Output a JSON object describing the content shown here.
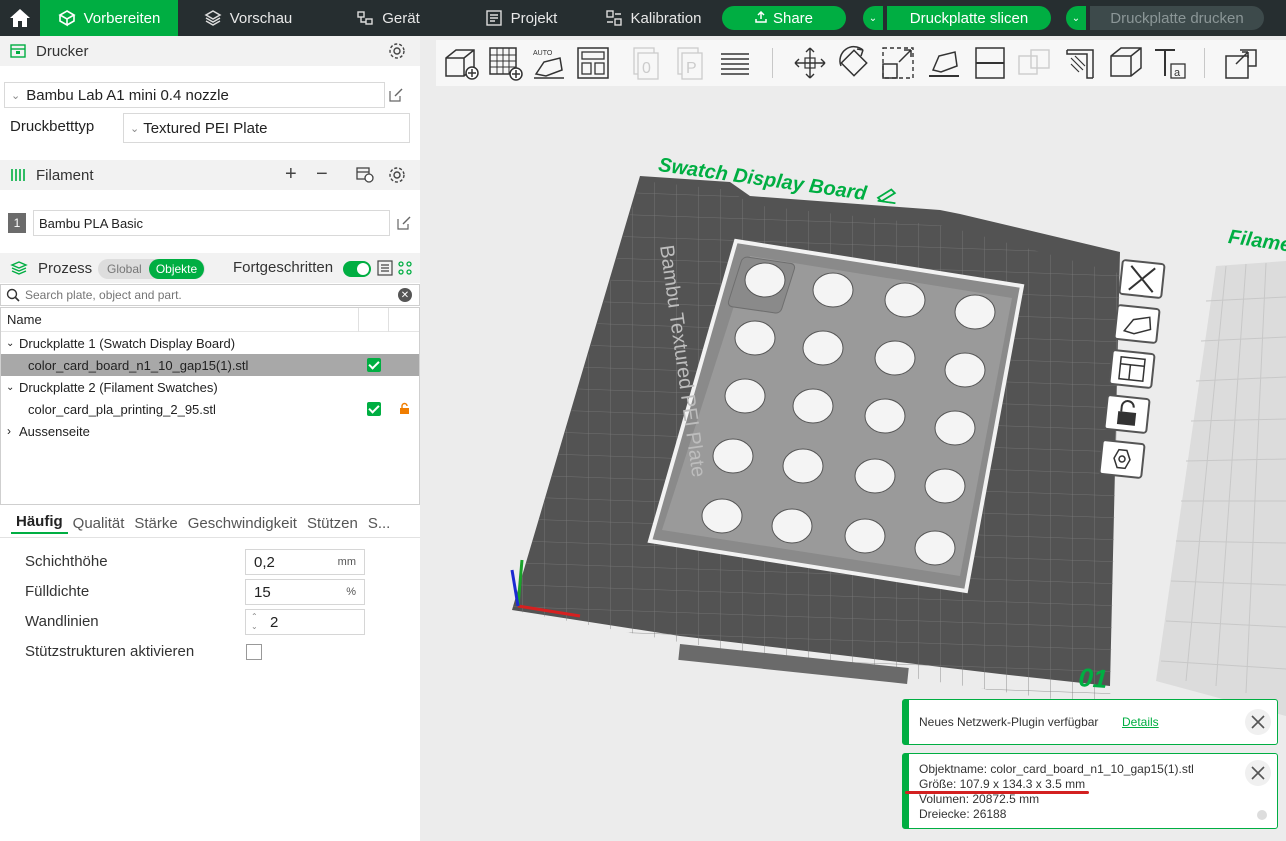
{
  "nav": {
    "tabs": [
      {
        "label": "Vorbereiten",
        "icon": "cube-icon"
      },
      {
        "label": "Vorschau",
        "icon": "layers-icon"
      },
      {
        "label": "Gerät",
        "icon": "device-icon"
      },
      {
        "label": "Projekt",
        "icon": "project-icon"
      },
      {
        "label": "Kalibration",
        "icon": "calibration-icon"
      }
    ],
    "share_label": "Share",
    "slice_label": "Druckplatte slicen",
    "print_label": "Druckplatte drucken",
    "accent": "#00ae42"
  },
  "printer": {
    "section_title": "Drucker",
    "printer_name": "Bambu Lab A1 mini 0.4 nozzle",
    "bed_type_label": "Druckbetttyp",
    "bed_type_value": "Textured PEI Plate"
  },
  "filament": {
    "section_title": "Filament",
    "slot_number": "1",
    "name": "Bambu PLA Basic"
  },
  "process": {
    "section_title": "Prozess",
    "toggle_global": "Global",
    "toggle_objects": "Objekte",
    "advanced_label": "Fortgeschritten",
    "search_placeholder": "Search plate, object and part.",
    "tree_header": "Name",
    "tree": [
      {
        "label": "Druckplatte 1 (Swatch Display Board)"
      },
      {
        "label": "color_card_board_n1_10_gap15(1).stl"
      },
      {
        "label": "Druckplatte 2 (Filament Swatches)"
      },
      {
        "label": "color_card_pla_printing_2_95.stl"
      },
      {
        "label": "Aussenseite"
      }
    ],
    "param_tabs": [
      "Häufig",
      "Qualität",
      "Stärke",
      "Geschwindigkeit",
      "Stützen",
      "S..."
    ],
    "params": {
      "layer_height_label": "Schichthöhe",
      "layer_height_value": "0,2",
      "layer_height_unit": "mm",
      "infill_label": "Fülldichte",
      "infill_value": "15",
      "infill_unit": "%",
      "walls_label": "Wandlinien",
      "walls_value": "2",
      "support_label": "Stützstrukturen aktivieren"
    }
  },
  "viewport": {
    "plate1_label": "Swatch Display Board",
    "plate2_label": "Filame",
    "plate_number": "01",
    "bed_text": "Bambu Textured PEI Plate",
    "toast_plugin": {
      "text": "Neues Netzwerk-Plugin verfügbar",
      "link": "Details"
    },
    "toast_object": {
      "name_line": "Objektname: color_card_board_n1_10_gap15(1).stl",
      "size_line": "Größe: 107.9 x 134.3 x 3.5 mm",
      "volume_line": "Volumen: 20872.5 mm",
      "triangles_line": "Dreiecke: 26188"
    }
  }
}
